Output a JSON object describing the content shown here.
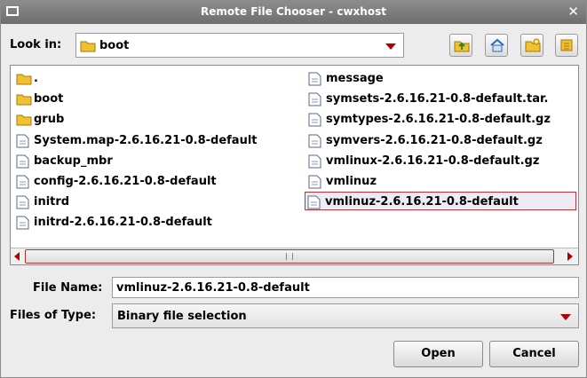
{
  "window": {
    "title": "Remote File Chooser - cwxhost"
  },
  "look_in": {
    "label": "Look in:",
    "value": "boot"
  },
  "toolbar": {
    "buttons": [
      "up-folder-icon",
      "home-icon",
      "new-folder-icon",
      "list-view-icon"
    ]
  },
  "files": {
    "column1": [
      {
        "name": ".",
        "type": "folder"
      },
      {
        "name": "boot",
        "type": "folder"
      },
      {
        "name": "grub",
        "type": "folder"
      },
      {
        "name": "System.map-2.6.16.21-0.8-default",
        "type": "file"
      },
      {
        "name": "backup_mbr",
        "type": "file"
      },
      {
        "name": "config-2.6.16.21-0.8-default",
        "type": "file"
      },
      {
        "name": "initrd",
        "type": "file"
      },
      {
        "name": "initrd-2.6.16.21-0.8-default",
        "type": "file"
      }
    ],
    "column2": [
      {
        "name": "message",
        "type": "file"
      },
      {
        "name": "symsets-2.6.16.21-0.8-default.tar.",
        "type": "file"
      },
      {
        "name": "symtypes-2.6.16.21-0.8-default.gz",
        "type": "file"
      },
      {
        "name": "symvers-2.6.16.21-0.8-default.gz",
        "type": "file"
      },
      {
        "name": "vmlinux-2.6.16.21-0.8-default.gz",
        "type": "file"
      },
      {
        "name": "vmlinuz",
        "type": "file"
      },
      {
        "name": "vmlinuz-2.6.16.21-0.8-default",
        "type": "file",
        "selected": true
      }
    ]
  },
  "file_name": {
    "label": "File Name:",
    "value": "vmlinuz-2.6.16.21-0.8-default"
  },
  "file_type": {
    "label": "Files of Type:",
    "value": "Binary file selection"
  },
  "buttons": {
    "open": "Open",
    "cancel": "Cancel"
  },
  "colors": {
    "accent": "#b00000",
    "selection_border": "#c0303a",
    "folder": "#f2c12e"
  }
}
